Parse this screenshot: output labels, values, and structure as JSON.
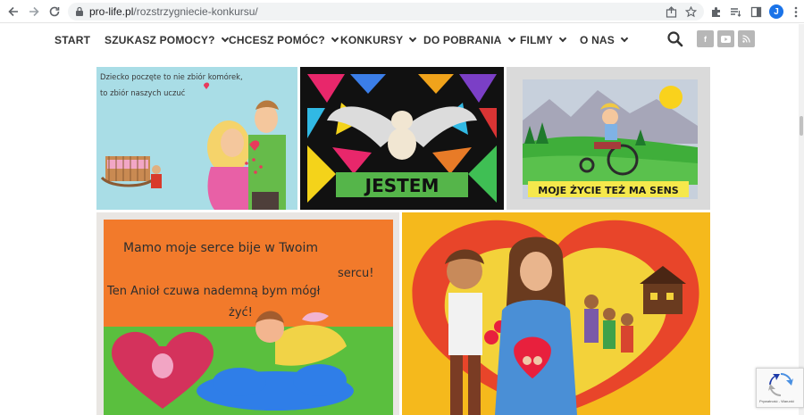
{
  "browser": {
    "url_domain": "pro-life.pl",
    "url_path": "/rozstrzygniecie-konkursu/",
    "profile_initial": "J"
  },
  "nav": {
    "items": [
      {
        "label": "START",
        "dropdown": false
      },
      {
        "label": "SZUKASZ POMOCY?",
        "dropdown": true
      },
      {
        "label": "CHCESZ POMÓC?",
        "dropdown": true
      },
      {
        "label": "KONKURSY",
        "dropdown": true
      },
      {
        "label": "DO POBRANIA",
        "dropdown": true
      },
      {
        "label": "FILMY",
        "dropdown": true
      },
      {
        "label": "O NAS",
        "dropdown": true
      }
    ],
    "social": [
      "f",
      "▶",
      "rss"
    ]
  },
  "gallery": {
    "drawing1_text_line1": "Dziecko poczęte to nie zbiór komórek,",
    "drawing1_text_line2": "to zbiór naszych uczuć",
    "drawing2_text": "JESTEM",
    "drawing3_text": "MOJE ŻYCIE TEŻ  MA SENS",
    "drawing4_text_line1": "Mamo moje serce bije w Twoim",
    "drawing4_text_line2": "sercu!",
    "drawing4_text_line3": "Ten Anioł czuwa nademną bym mógł",
    "drawing4_text_line4": "żyć!"
  },
  "recaptcha": {
    "footer": "Prywatność - Warunki"
  },
  "colors": {
    "nav_text": "#333333",
    "social_bg": "#b7b7b7",
    "profile": "#1a73e8"
  }
}
